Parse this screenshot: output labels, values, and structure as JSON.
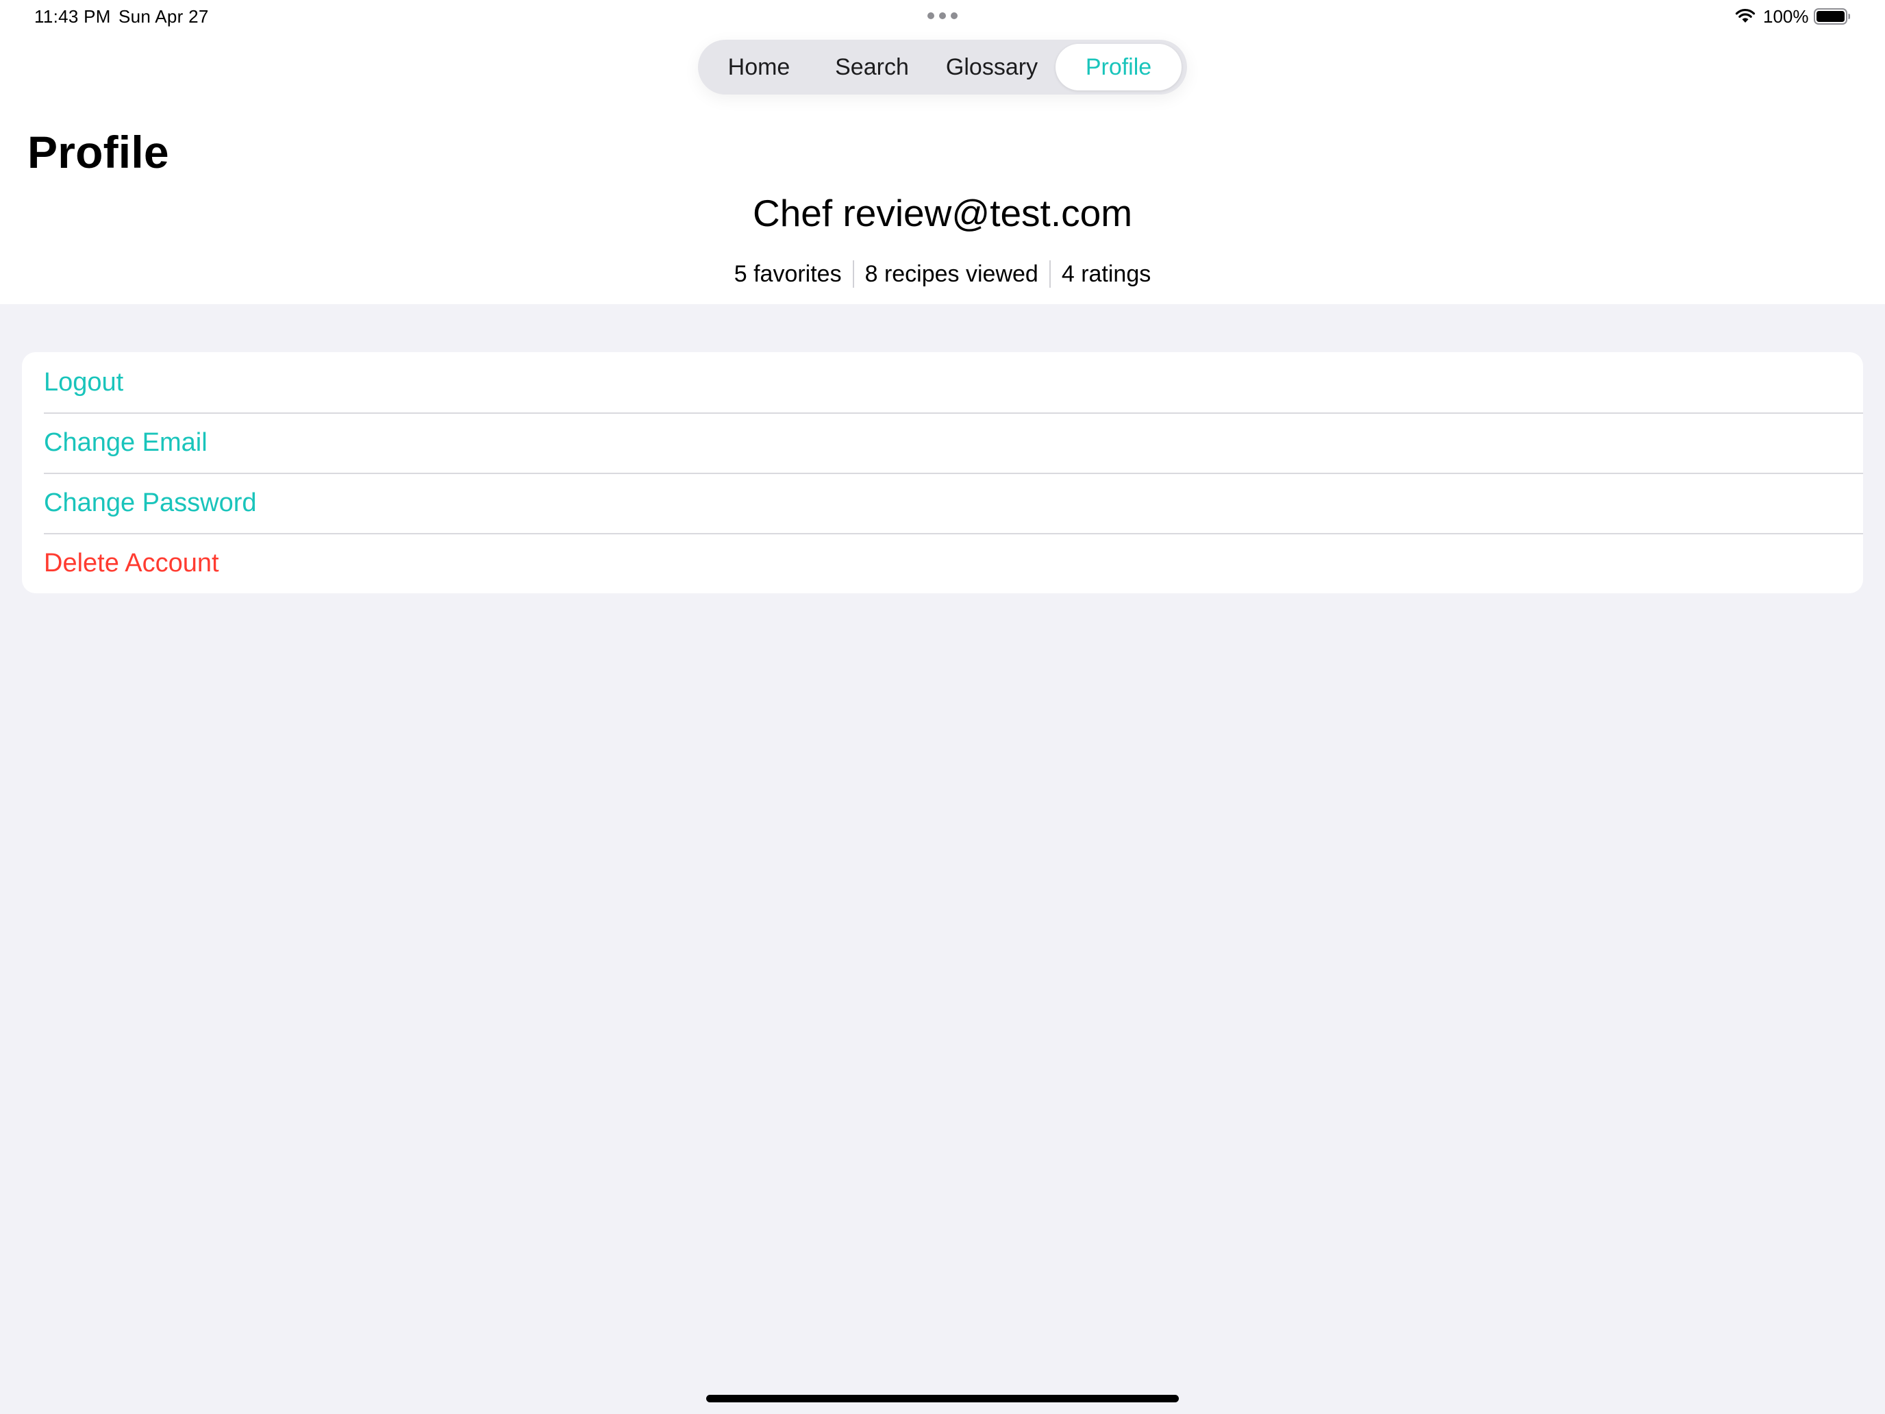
{
  "status_bar": {
    "time": "11:43 PM",
    "date": "Sun Apr 27",
    "battery_percent": "100%",
    "battery_level": 1.0,
    "icons": [
      "multitasking-dots-icon",
      "wifi-icon",
      "battery-icon"
    ]
  },
  "tabs": [
    {
      "label": "Home",
      "selected": false
    },
    {
      "label": "Search",
      "selected": false
    },
    {
      "label": "Glossary",
      "selected": false
    },
    {
      "label": "Profile",
      "selected": true
    }
  ],
  "page": {
    "title": "Profile"
  },
  "profile": {
    "name": "Chef review@test.com",
    "stats": {
      "favorites": "5 favorites",
      "recipes_viewed": "8 recipes viewed",
      "ratings": "4 ratings"
    }
  },
  "actions": [
    {
      "label": "Logout",
      "style": "accent"
    },
    {
      "label": "Change Email",
      "style": "accent"
    },
    {
      "label": "Change Password",
      "style": "accent"
    },
    {
      "label": "Delete Account",
      "style": "destructive"
    }
  ],
  "colors": {
    "accent": "#19c4bb",
    "destructive": "#ff3b30",
    "background": "#f2f2f7",
    "card": "#ffffff"
  }
}
